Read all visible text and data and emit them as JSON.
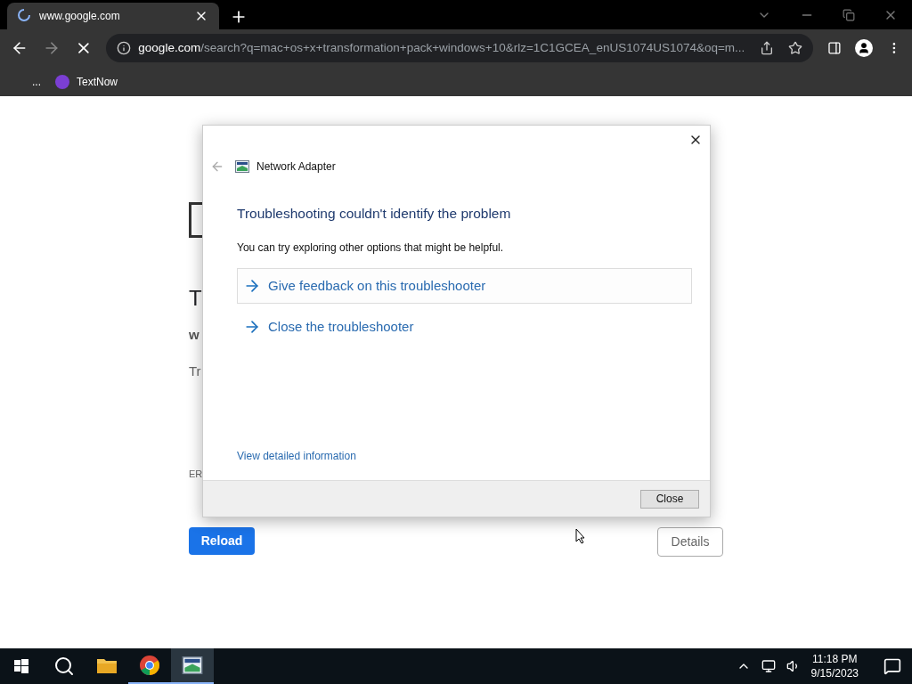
{
  "browser": {
    "tabs": [
      {
        "title": "www.google.com",
        "selected": true
      }
    ],
    "address": {
      "domain": "google.com",
      "path": "/search?q=mac+os+x+transformation+pack+windows+10&rlz=1C1GCEA_enUS1074US1074&oq=m..."
    },
    "bookmarks": [
      {
        "label": "..."
      },
      {
        "label": "TextNow"
      }
    ]
  },
  "page": {
    "title_fragment": "T",
    "host_fragment": "w",
    "hint_fragment": "Tr",
    "code_fragment": "ER",
    "reload_button": "Reload",
    "details_button": "Details"
  },
  "dialog": {
    "title": "Network Adapter",
    "heading": "Troubleshooting couldn't identify the problem",
    "message": "You can try exploring other options that might be helpful.",
    "options": [
      {
        "label": "Give feedback on this troubleshooter",
        "selected": true
      },
      {
        "label": "Close the troubleshooter",
        "selected": false
      }
    ],
    "details_link": "View detailed information",
    "close_button": "Close"
  },
  "taskbar": {
    "apps": [
      {
        "kind": "folder",
        "running": false,
        "selected": false
      },
      {
        "kind": "chrome",
        "running": true,
        "selected": false
      },
      {
        "kind": "adapter",
        "running": true,
        "selected": true
      }
    ],
    "time": "11:18 PM",
    "date": "9/15/2023"
  }
}
